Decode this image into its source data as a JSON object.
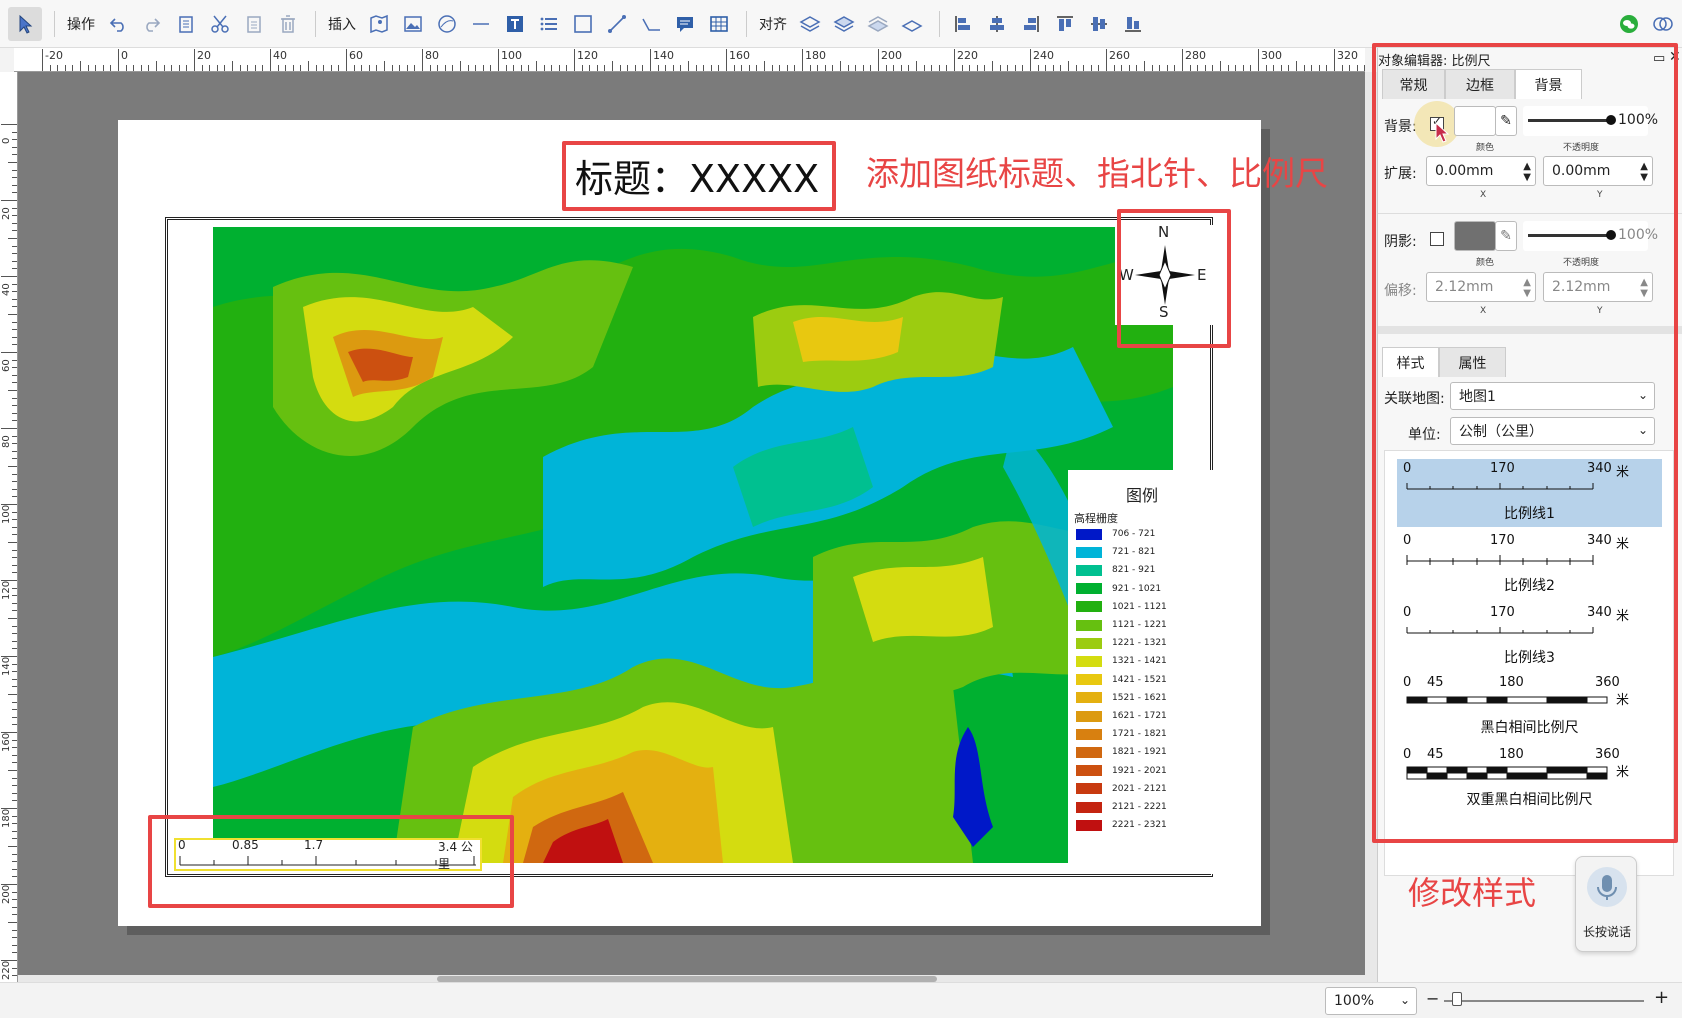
{
  "toolbar": {
    "operate_label": "操作",
    "insert_label": "插入",
    "align_label": "对齐"
  },
  "ruler": {
    "h_labels": [
      "-20",
      "0",
      "20",
      "40",
      "60",
      "80",
      "100",
      "120",
      "140",
      "160",
      "180",
      "200",
      "220",
      "240",
      "260",
      "280",
      "300",
      "320"
    ],
    "v_labels": [
      "0",
      "20",
      "40",
      "60",
      "80",
      "100",
      "120",
      "140",
      "160",
      "180",
      "200",
      "220"
    ]
  },
  "layout": {
    "title_text": "标题：XXXXX",
    "annotation_top": "添加图纸标题、指北针、比例尺",
    "annotation_bottom": "修改样式",
    "compass": {
      "n": "N",
      "s": "S",
      "e": "E",
      "w": "W"
    },
    "legend": {
      "title": "图例",
      "subtitle": "高程栅度",
      "items": [
        {
          "label": "706 - 721",
          "color": "#0018c8"
        },
        {
          "label": "721 - 821",
          "color": "#00b4d8"
        },
        {
          "label": "821 - 921",
          "color": "#00c090"
        },
        {
          "label": "921 - 1021",
          "color": "#00b030"
        },
        {
          "label": "1021 - 1121",
          "color": "#22b010"
        },
        {
          "label": "1121 - 1221",
          "color": "#66c010"
        },
        {
          "label": "1221 - 1321",
          "color": "#9ccc10"
        },
        {
          "label": "1321 - 1421",
          "color": "#d4dc10"
        },
        {
          "label": "1421 - 1521",
          "color": "#e8c810"
        },
        {
          "label": "1521 - 1621",
          "color": "#e4b010"
        },
        {
          "label": "1621 - 1721",
          "color": "#dc9a10"
        },
        {
          "label": "1721 - 1821",
          "color": "#d88010"
        },
        {
          "label": "1821 - 1921",
          "color": "#d06810"
        },
        {
          "label": "1921 - 2021",
          "color": "#cc5010"
        },
        {
          "label": "2021 - 2121",
          "color": "#c83a10"
        },
        {
          "label": "2121 - 2221",
          "color": "#c42410"
        },
        {
          "label": "2221 - 2321",
          "color": "#c01010"
        }
      ]
    },
    "scalebar": {
      "labels": [
        "0",
        "0.85",
        "1.7",
        "3.4 公里"
      ]
    }
  },
  "panel": {
    "title": "对象编辑器: 比例尺",
    "tabs_top": [
      "常规",
      "边框",
      "背景"
    ],
    "active_top_tab": "背景",
    "background_label": "背景:",
    "background_checked": true,
    "background_opacity": "100%",
    "color_sub": "颜色",
    "opacity_sub": "不透明度",
    "expand_label": "扩展:",
    "expand_x": "0.00mm",
    "expand_y": "0.00mm",
    "x_sub": "X",
    "y_sub": "Y",
    "shadow_label": "阴影:",
    "shadow_checked": false,
    "shadow_opacity": "100%",
    "offset_label": "偏移:",
    "offset_x": "2.12mm",
    "offset_y": "2.12mm",
    "tabs_bottom": [
      "样式",
      "属性"
    ],
    "active_bottom_tab": "样式",
    "linked_map_label": "关联地图:",
    "linked_map_value": "地图1",
    "unit_label": "单位:",
    "unit_value": "公制（公里）",
    "scale_styles": [
      {
        "name": "比例线1",
        "labels": [
          "0",
          "170",
          "340",
          "米"
        ],
        "selected": true
      },
      {
        "name": "比例线2",
        "labels": [
          "0",
          "170",
          "340",
          "米"
        ],
        "selected": false
      },
      {
        "name": "比例线3",
        "labels": [
          "0",
          "170",
          "340",
          "米"
        ],
        "selected": false
      },
      {
        "name": "黑白相间比例尺",
        "labels": [
          "0",
          "45",
          "180",
          "360",
          "米"
        ],
        "selected": false
      },
      {
        "name": "双重黑白相间比例尺",
        "labels": [
          "0",
          "45",
          "180",
          "360",
          "米"
        ],
        "selected": false
      }
    ],
    "voice_label": "长按说话"
  },
  "status": {
    "zoom_value": "100%",
    "zoom_level": 0.1
  },
  "colors": {
    "accent_red": "#e84545",
    "canvas_gray": "#7b7b7b",
    "selected_style": "#b7d2ea"
  }
}
